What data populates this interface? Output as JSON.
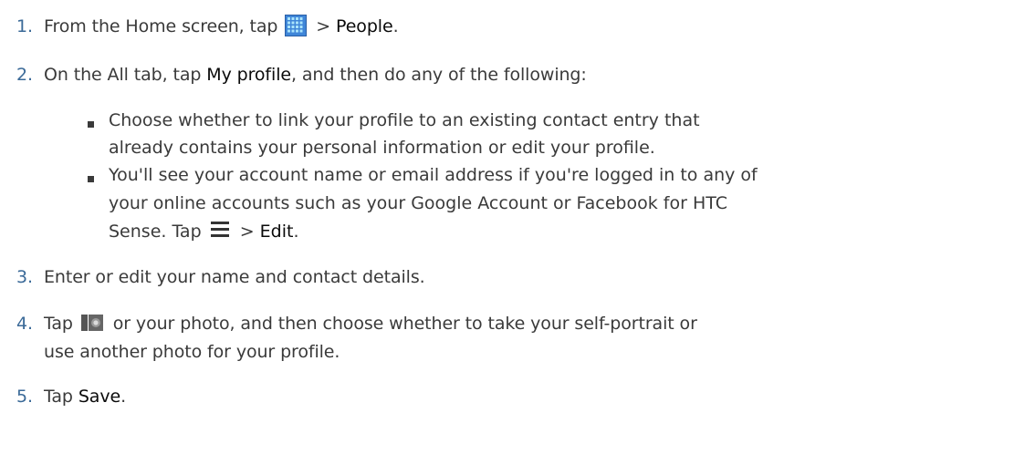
{
  "steps": [
    {
      "number": "1.",
      "pre": "From the Home screen, tap ",
      "icon": "apps-grid-icon",
      "mid": " > ",
      "ui": "People",
      "post": "."
    },
    {
      "number": "2.",
      "pre": "On the All tab, tap ",
      "ui": "My profile",
      "post": ", and then do any of the following:"
    },
    {
      "number": "3.",
      "text": "Enter or edit your name and contact details."
    },
    {
      "number": "4.",
      "pre": "Tap ",
      "icon": "camera-icon",
      "line1": " or your photo, and then choose whether to take your self-portrait or",
      "line2": "use another photo for your profile."
    },
    {
      "number": "5.",
      "pre": "Tap ",
      "ui": "Save",
      "post": "."
    }
  ],
  "bullets": [
    {
      "line1": "Choose whether to link your profile to an existing contact entry that",
      "line2": "already contains your personal information or edit your profile."
    },
    {
      "line1": "You'll see your account name or email address if you're logged in to any of",
      "line2": "your online accounts such as your Google Account or Facebook for HTC",
      "line3_pre": "Sense. Tap ",
      "icon": "menu-icon",
      "line3_mid": " > ",
      "line3_ui": "Edit",
      "line3_post": "."
    }
  ],
  "colors": {
    "step_number": "#3b6a98",
    "text": "#3a3a3a",
    "ui_term": "#0a0a0a",
    "grid_icon": "#3f86d8"
  }
}
